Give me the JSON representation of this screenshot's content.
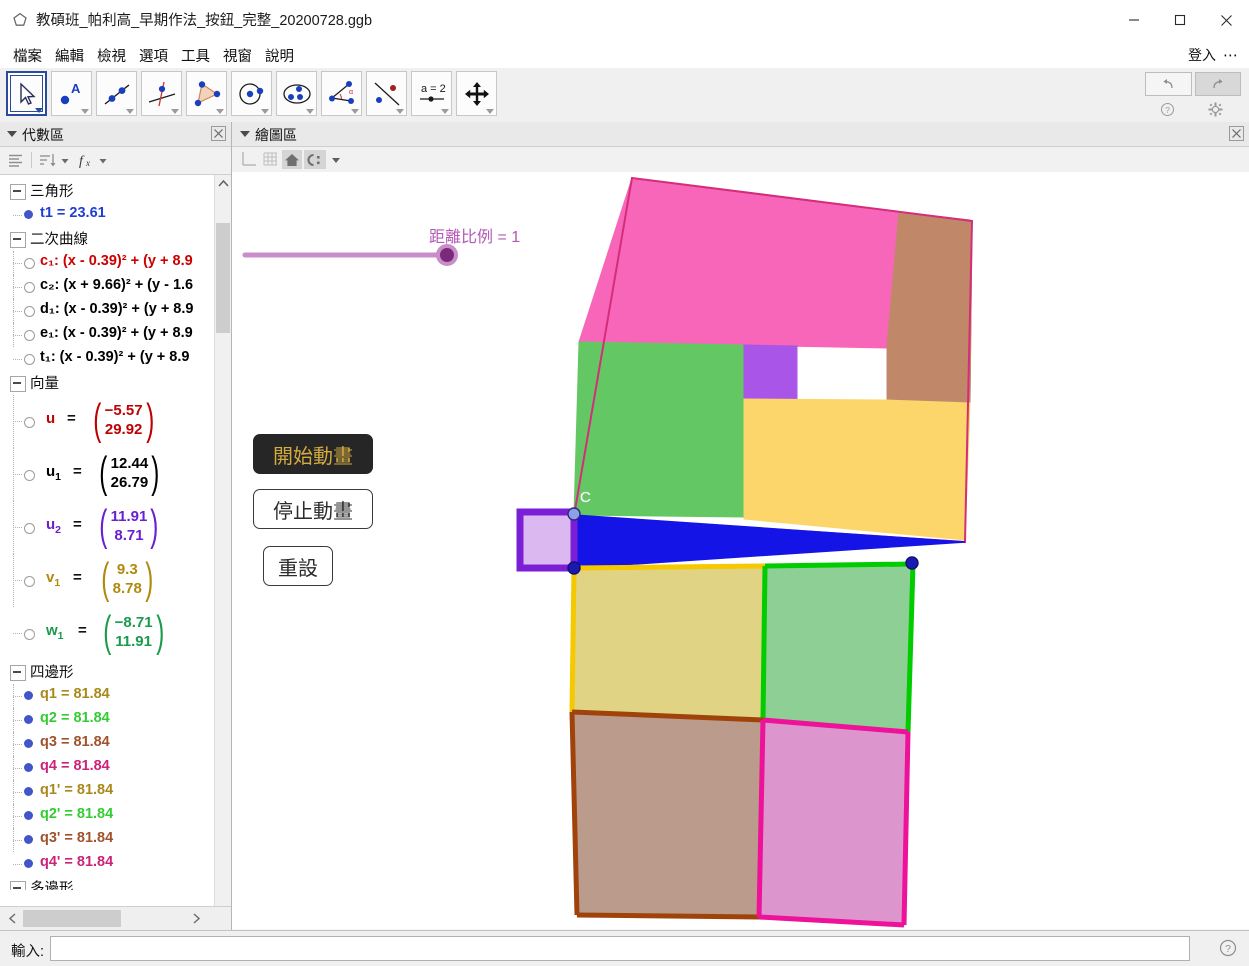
{
  "window": {
    "title": "教碩班_帕利高_早期作法_按鈕_完整_20200728.ggb",
    "minimize_label": "minimize",
    "maximize_label": "maximize",
    "close_label": "close"
  },
  "menubar": {
    "items": [
      "檔案",
      "編輯",
      "檢視",
      "選項",
      "工具",
      "視窗",
      "說明"
    ],
    "signin": "登入",
    "more": "⋯"
  },
  "toolbar": {
    "tools": [
      {
        "name": "move-tool",
        "selected": true
      },
      {
        "name": "point-tool",
        "selected": false
      },
      {
        "name": "line-tool",
        "selected": false
      },
      {
        "name": "perpendicular-line-tool",
        "selected": false
      },
      {
        "name": "polygon-tool",
        "selected": false
      },
      {
        "name": "circle-tool",
        "selected": false
      },
      {
        "name": "ellipse-tool",
        "selected": false
      },
      {
        "name": "angle-tool",
        "selected": false
      },
      {
        "name": "reflect-tool",
        "selected": false
      },
      {
        "name": "slider-tool",
        "selected": false,
        "caption": "a = 2"
      },
      {
        "name": "move-graphics-tool",
        "selected": false
      }
    ],
    "undo_label": "復原",
    "redo_label": "重做",
    "help_label": "說明",
    "settings_label": "設定"
  },
  "algebra_panel": {
    "title": "代數區",
    "close_label": "關閉",
    "groups": [
      {
        "name": "三角形",
        "items": [
          {
            "label": "t1 = 23.61",
            "color": "#1f3fd4",
            "marker": "filled"
          }
        ]
      },
      {
        "name": "二次曲線",
        "items": [
          {
            "label": "c₁: (x - 0.39)² + (y + 8.9",
            "color": "#cc0000",
            "marker": "hollow"
          },
          {
            "label": "c₂: (x + 9.66)² + (y - 1.6",
            "color": "#000000",
            "marker": "hollow"
          },
          {
            "label": "d₁: (x - 0.39)² + (y + 8.9",
            "color": "#000000",
            "marker": "hollow"
          },
          {
            "label": "e₁: (x - 0.39)² + (y + 8.9",
            "color": "#000000",
            "marker": "hollow"
          },
          {
            "label": "t₁: (x - 0.39)² + (y + 8.9",
            "color": "#000000",
            "marker": "hollow"
          }
        ]
      },
      {
        "name": "向量",
        "vectors": [
          {
            "name": "u",
            "sub": "",
            "x": "−5.57",
            "y": "29.92",
            "color": "#c00000"
          },
          {
            "name": "u",
            "sub": "1",
            "x": "12.44",
            "y": "26.79",
            "color": "#000000"
          },
          {
            "name": "u",
            "sub": "2",
            "x": "11.91",
            "y": "8.71",
            "color": "#6a20d0"
          },
          {
            "name": "v",
            "sub": "1",
            "x": "9.3",
            "y": "8.78",
            "color": "#b08a0e"
          },
          {
            "name": "w",
            "sub": "1",
            "x": "−8.71",
            "y": "11.91",
            "color": "#1a9b4b"
          }
        ]
      },
      {
        "name": "四邊形",
        "items": [
          {
            "label": "q1 = 81.84",
            "color": "#a8891b",
            "marker": "filled"
          },
          {
            "label": "q2 = 81.84",
            "color": "#33cc33",
            "marker": "filled"
          },
          {
            "label": "q3 = 81.84",
            "color": "#a0522d",
            "marker": "filled"
          },
          {
            "label": "q4 = 81.84",
            "color": "#cc2277",
            "marker": "filled"
          },
          {
            "label": "q1' = 81.84",
            "color": "#a8891b",
            "marker": "filled"
          },
          {
            "label": "q2' = 81.84",
            "color": "#33cc33",
            "marker": "filled"
          },
          {
            "label": "q3' = 81.84",
            "color": "#a0522d",
            "marker": "filled"
          },
          {
            "label": "q4' = 81.84",
            "color": "#cc2277",
            "marker": "filled"
          }
        ]
      },
      {
        "name": "多邊形",
        "clipped": true,
        "items": []
      }
    ]
  },
  "graphics_panel": {
    "title": "繪圖區",
    "close_label": "關閉",
    "tool_icons": [
      "axes-icon",
      "grid-icon",
      "home-icon",
      "snap-icon"
    ],
    "slider": {
      "label": "距離比例 = 1",
      "value": 1,
      "min": 0,
      "max": 1,
      "color": "#b459b4"
    },
    "buttons": [
      {
        "label": "開始動畫",
        "style": "dark"
      },
      {
        "label": "停止動畫",
        "style": "light"
      },
      {
        "label": "重設",
        "style": "light"
      }
    ],
    "point_labels": [
      {
        "label": "C",
        "color": "#ffffff"
      }
    ],
    "figure_colors": {
      "pink": "#f766b8",
      "brown_top": "#c08868",
      "green_top": "#63c863",
      "purple_small": "#a855e8",
      "yellow_top": "#fcd66a",
      "blue_triangle": "#1414e6",
      "crimson_outline": "#d42d79",
      "violet_square": "#7b1fd6",
      "violet_fill": "#dcb8f0",
      "olive_fill": "#e0d384",
      "green_fill": "#8ecf96",
      "brown_fill": "#bb9b8c",
      "magenta_fill": "#dd96cd",
      "gold_edge": "#f5c800",
      "green_edge": "#00cc00",
      "brown_edge": "#a0430a",
      "magenta_edge": "#ee1199"
    }
  },
  "input_bar": {
    "label": "輸入:",
    "value": "",
    "placeholder": "",
    "help_label": "說明"
  }
}
